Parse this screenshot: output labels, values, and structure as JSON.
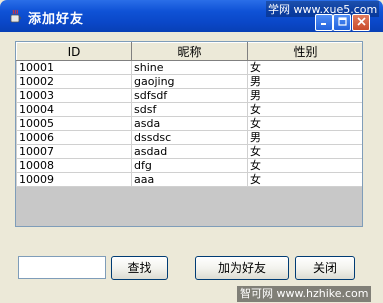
{
  "window": {
    "title": "添加好友",
    "watermark_top": "学网 www.xue5.com",
    "watermark_bottom": "智可网 www.hzhike.com"
  },
  "table": {
    "columns": [
      "ID",
      "昵称",
      "性别"
    ],
    "rows": [
      [
        "10001",
        "shine",
        "女"
      ],
      [
        "10002",
        "gaojing",
        "男"
      ],
      [
        "10003",
        "sdfsdf",
        "男"
      ],
      [
        "10004",
        "sdsf",
        "女"
      ],
      [
        "10005",
        "asda",
        "女"
      ],
      [
        "10006",
        "dssdsc",
        "男"
      ],
      [
        "10007",
        "asdad",
        "女"
      ],
      [
        "10008",
        "dfg",
        "女"
      ],
      [
        "10009",
        "aaa",
        "女"
      ]
    ]
  },
  "search": {
    "value": ""
  },
  "buttons": {
    "search": "查找",
    "add_friend": "加为好友",
    "close": "关闭"
  },
  "icons": {
    "app": "java-coffee-icon",
    "minimize": "minimize-icon",
    "maximize": "maximize-icon",
    "close": "close-icon"
  }
}
